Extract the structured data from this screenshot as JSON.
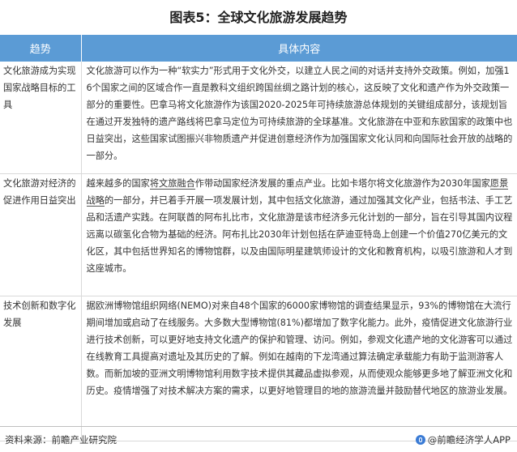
{
  "title": "图表5：全球文化旅游发展趋势",
  "table": {
    "headers": [
      "趋势",
      "具体内容"
    ],
    "rows": [
      {
        "trend": "文化旅游成为实现国家战略目标的工具",
        "content": "文化旅游可以作为一种“软实力”形式用于文化外交，以建立人民之间的对话并支持外交政策。例如，加强16个国家之间的区域合作一直是教科文组织跨国丝绸之路计划的核心，这反映了文化和遗产作为外交政策一部分的重要性。巴拿马将文化旅游作为该国2020-2025年可持续旅游总体规划的关键组成部分，该规划旨在通过开发独特的遗产路线将巴拿马定位为可持续旅游的全球基准。文化旅游在中亚和东欧国家的政策中也日益突出，这些国家试图振兴非物质遗产并促进创意经济作为加强国家文化认同和向国际社会开放的战略的一部分。"
      },
      {
        "trend": "文化旅游对经济的促进作用日益突出",
        "content_a": "越来越多的国家",
        "content_b": "将文旅融合",
        "content_c": "作带动国家经济发展的重点产业。比如卡塔尔将文化旅游作为2030年国家",
        "content_d": "愿景战略",
        "content_e": "的一部分，并已着手开展一项发展计划，其中包括文化旅游，通过加强其文化产业，包括书法、手工艺品和活遗产实践。在阿联酋的阿布扎比市，文化旅游是该市经济多元化计划的一部分，旨在引导其国内议程远离以碳氢化合物为基础的经济。阿布扎比2030年计划包括在萨迪亚特岛上创建一个价值270亿美元的文化区，其中包括世界知名的博物馆群，以及由国际明星建筑师设计的文化和教育机构，以吸引旅游和人才到这座城市。"
      },
      {
        "trend": "技术创新和数字化发展",
        "content": "据欧洲博物馆组织网络(NEMO)对来自48个国家的6000家博物馆的调查结果显示，93%的博物馆在大流行期间增加或启动了在线服务。大多数大型博物馆(81%)都增加了数字化能力。此外，疫情促进文化旅游行业进行技术创新，可以更好地支持文化遗产的保护和管理、访问。例如，参观文化遗产地的文化游客可以通过在线教育工具提高对遗址及其历史的了解。例如在越南的下龙湾通过算法确定承载能力有助于监测游客人数。而新加坡的亚洲文明博物馆利用数字技术提供其藏品虚拟参观，从而使观众能够更多地了解亚洲文化和历史。疫情增强了对技术解决方案的需求，以更好地管理目的地的旅游流量并鼓励替代地区的旅游业发展。"
      }
    ]
  },
  "footer": {
    "source": "资料来源：前瞻产业研究院",
    "brand": "@前瞻经济学人APP"
  }
}
